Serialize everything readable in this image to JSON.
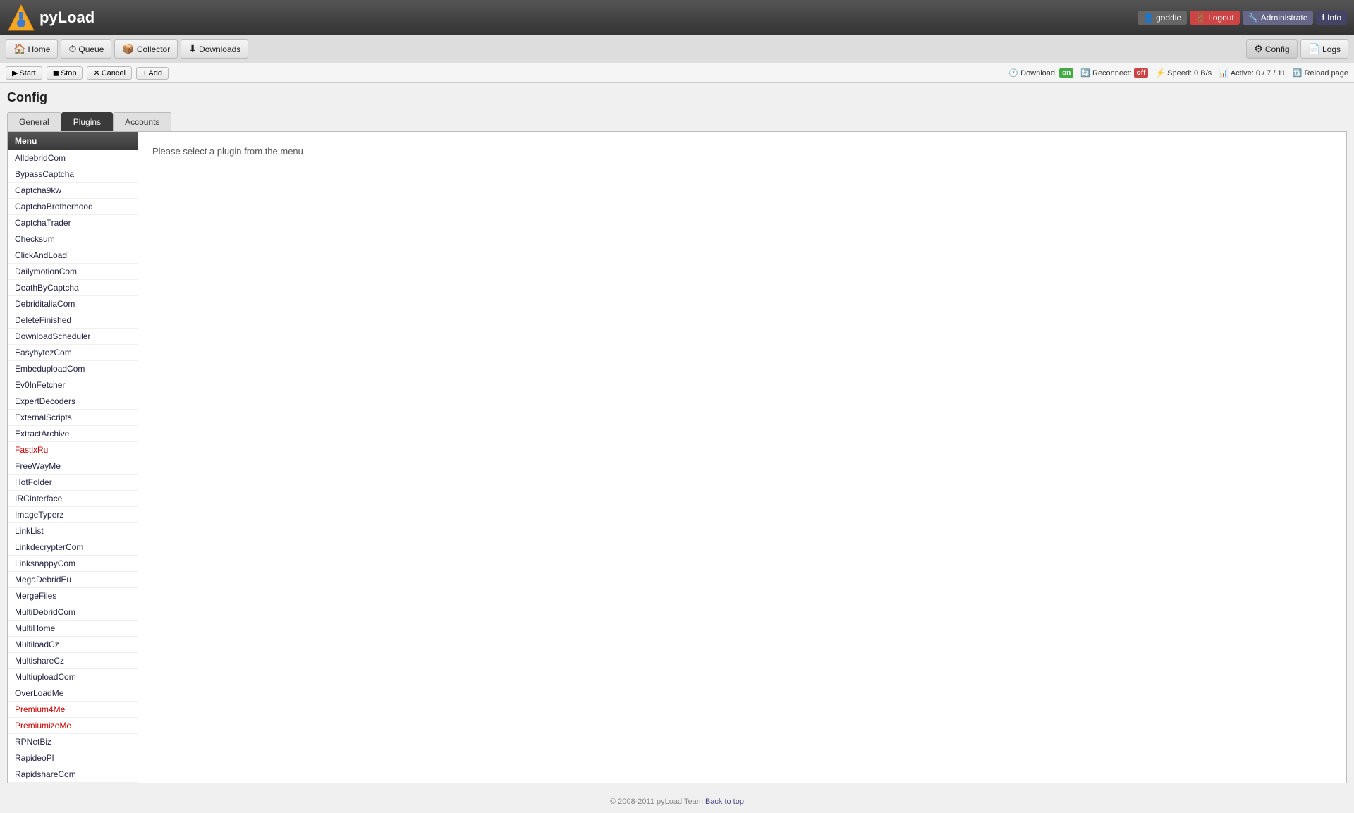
{
  "header": {
    "logo_text": "pyLoad",
    "user": "goddie",
    "logout_label": "Logout",
    "administrate_label": "Administrate",
    "info_label": "Info"
  },
  "navbar": {
    "items": [
      {
        "id": "home",
        "label": "Home",
        "icon": "🏠"
      },
      {
        "id": "queue",
        "label": "Queue",
        "icon": "⏱"
      },
      {
        "id": "collector",
        "label": "Collector",
        "icon": "📦"
      },
      {
        "id": "downloads",
        "label": "Downloads",
        "icon": "⬇"
      }
    ],
    "right_items": [
      {
        "id": "config",
        "label": "Config",
        "icon": "⚙"
      },
      {
        "id": "logs",
        "label": "Logs",
        "icon": "📄"
      }
    ]
  },
  "toolbar": {
    "start_label": "Start",
    "stop_label": "Stop",
    "cancel_label": "Cancel",
    "add_label": "Add",
    "download_label": "Download:",
    "download_status": "on",
    "reconnect_label": "Reconnect:",
    "reconnect_status": "off",
    "speed_label": "Speed: 0 B/s",
    "active_label": "Active: 0 / 7 / 11",
    "reload_label": "Reload page"
  },
  "page": {
    "title": "Config",
    "tabs": [
      {
        "id": "general",
        "label": "General"
      },
      {
        "id": "plugins",
        "label": "Plugins"
      },
      {
        "id": "accounts",
        "label": "Accounts"
      }
    ],
    "active_tab": "plugins"
  },
  "sidebar": {
    "menu_header": "Menu",
    "items": [
      {
        "label": "AlldebridCom",
        "highlighted": false
      },
      {
        "label": "BypassCaptcha",
        "highlighted": false
      },
      {
        "label": "Captcha9kw",
        "highlighted": false
      },
      {
        "label": "CaptchaBrotherhood",
        "highlighted": false
      },
      {
        "label": "CaptchaTrader",
        "highlighted": false
      },
      {
        "label": "Checksum",
        "highlighted": false
      },
      {
        "label": "ClickAndLoad",
        "highlighted": false
      },
      {
        "label": "DailymotionCom",
        "highlighted": false
      },
      {
        "label": "DeathByCaptcha",
        "highlighted": false
      },
      {
        "label": "DebriditaliaCom",
        "highlighted": false
      },
      {
        "label": "DeleteFinished",
        "highlighted": false
      },
      {
        "label": "DownloadScheduler",
        "highlighted": false
      },
      {
        "label": "EasybytezCom",
        "highlighted": false
      },
      {
        "label": "EmbeduploadCom",
        "highlighted": false
      },
      {
        "label": "Ev0InFetcher",
        "highlighted": false
      },
      {
        "label": "ExpertDecoders",
        "highlighted": false
      },
      {
        "label": "ExternalScripts",
        "highlighted": false
      },
      {
        "label": "ExtractArchive",
        "highlighted": false
      },
      {
        "label": "FastixRu",
        "highlighted": true
      },
      {
        "label": "FreeWayMe",
        "highlighted": false
      },
      {
        "label": "HotFolder",
        "highlighted": false
      },
      {
        "label": "IRCInterface",
        "highlighted": false
      },
      {
        "label": "ImageTyperz",
        "highlighted": false
      },
      {
        "label": "LinkList",
        "highlighted": false
      },
      {
        "label": "LinkdecrypterCom",
        "highlighted": false
      },
      {
        "label": "LinksnappyCom",
        "highlighted": false
      },
      {
        "label": "MegaDebridEu",
        "highlighted": false
      },
      {
        "label": "MergeFiles",
        "highlighted": false
      },
      {
        "label": "MultiDebridCom",
        "highlighted": false
      },
      {
        "label": "MultiHome",
        "highlighted": false
      },
      {
        "label": "MultiloadCz",
        "highlighted": false
      },
      {
        "label": "MultishareCz",
        "highlighted": false
      },
      {
        "label": "MultiuploadCom",
        "highlighted": false
      },
      {
        "label": "OverLoadMe",
        "highlighted": false
      },
      {
        "label": "Premium4Me",
        "highlighted": true
      },
      {
        "label": "PremiumizeMe",
        "highlighted": true
      },
      {
        "label": "RPNetBiz",
        "highlighted": false
      },
      {
        "label": "RapideoPl",
        "highlighted": false
      },
      {
        "label": "RapidshareCom",
        "highlighted": false
      }
    ]
  },
  "main_panel": {
    "placeholder_text": "Please select a plugin from the menu"
  },
  "footer": {
    "copyright": "© 2008-2011 pyLoad Team",
    "back_to_top_label": "Back to top"
  }
}
